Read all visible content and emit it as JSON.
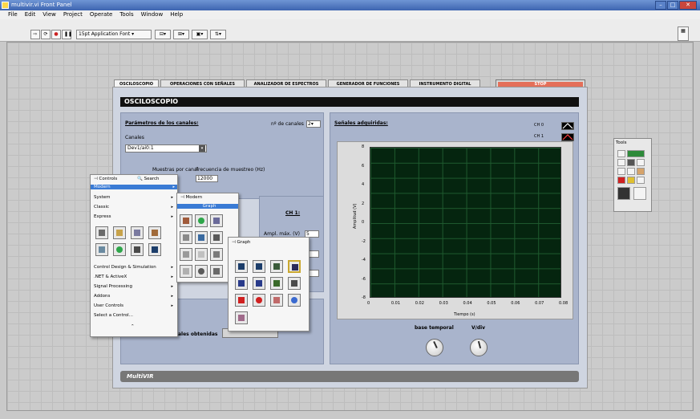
{
  "window": {
    "title": "multivir.vi Front Panel"
  },
  "menubar": [
    "File",
    "Edit",
    "View",
    "Project",
    "Operate",
    "Tools",
    "Window",
    "Help"
  ],
  "toolbar": {
    "font": "15pt Application Font"
  },
  "tabs": [
    "OSCILOSCOPIO",
    "OPERACIONES CON SEÑALES",
    "ANALIZADOR DE ESPECTROS",
    "GENERADOR DE FUNCIONES",
    "INSTRUMENTO DIGITAL"
  ],
  "stop_label": "STOP",
  "page_title": "OSCILOSCOPIO",
  "left_panel": {
    "heading": "Parámetros de los canales:",
    "num_channels_label": "nº de canales",
    "num_channels_value": "2",
    "channels_label": "Canales",
    "channels_value": "Dev1/ai0:1",
    "samples_label": "Muestras por canal",
    "freq_label": "Frecuencia de muestreo (Hz)",
    "freq_value": "12000",
    "ch1_label": "CH 1:",
    "ampl_label": "Ampl. máx. (V)",
    "ampl_value": "5",
    "signals_btn": "ales obtenidas"
  },
  "right_panel": {
    "heading": "Señales adquiridas:",
    "legend": [
      "CH 0",
      "CH 1"
    ],
    "legend_colors": [
      "#ffffff",
      "#ff4040"
    ],
    "timebase_label": "base temporal",
    "vdiv_label": "V/div"
  },
  "chart_data": {
    "type": "line",
    "xlabel": "Tiempo (s)",
    "ylabel": "Amplitud (V)",
    "xlim": [
      0,
      0.08
    ],
    "ylim": [
      -8,
      8
    ],
    "x_ticks": [
      "0",
      "0.01",
      "0.02",
      "0.03",
      "0.04",
      "0.05",
      "0.06",
      "0.07",
      "0.08"
    ],
    "y_ticks": [
      "8",
      "6",
      "4",
      "2",
      "0",
      "-2",
      "-4",
      "-6",
      "-8"
    ],
    "grid": true,
    "series": []
  },
  "bottom_bar": "MultiVIR",
  "controls_menu": {
    "title": "Controls",
    "search": "Search",
    "items": [
      "Modern",
      "System",
      "Classic",
      "Express",
      "Control Design & Simulation",
      ".NET & ActiveX",
      "Signal Processing",
      "Addons",
      "User Controls",
      "Select a Control..."
    ]
  },
  "modern_menu": {
    "title": "Modern",
    "highlight": "Graph"
  },
  "graph_menu": {
    "title": "Graph"
  },
  "tools_palette": {
    "title": "Tools"
  }
}
